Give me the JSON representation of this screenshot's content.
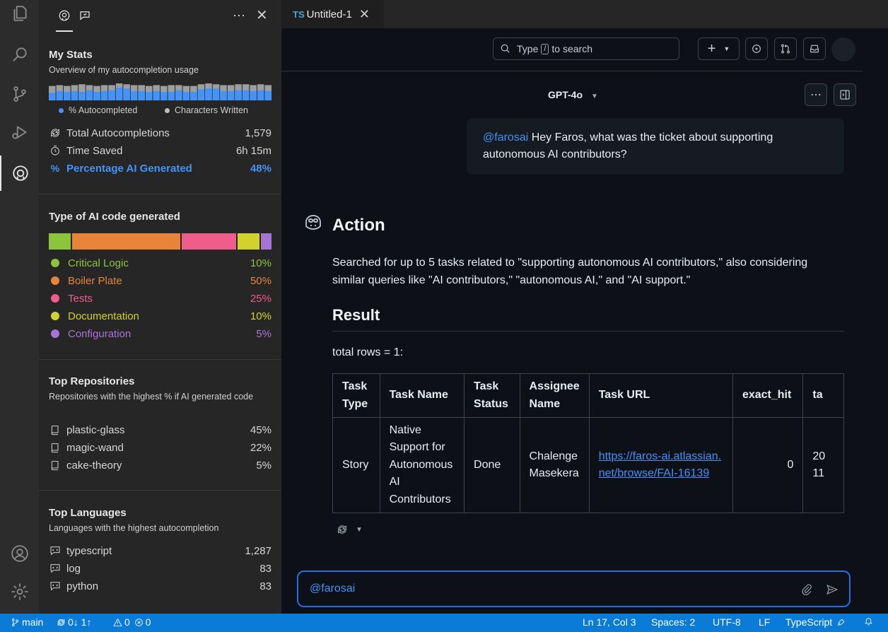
{
  "sidebar": {
    "my_stats": {
      "title": "My Stats",
      "subtitle": "Overview of my autocompletion usage",
      "legend_autocompleted": "% Autocompleted",
      "legend_characters": "Characters Written",
      "rows": [
        {
          "label": "Total Autocompletions",
          "value": "1,579",
          "icon": "refresh-icon"
        },
        {
          "label": "Time Saved",
          "value": "6h 15m",
          "icon": "stopwatch-icon"
        },
        {
          "label": "Percentage AI Generated",
          "value": "48%",
          "icon": "percent-icon"
        }
      ],
      "accent": "#4493f8",
      "bar_autocompleted": [
        0.45,
        0.55,
        0.5,
        0.55,
        0.5,
        0.6,
        0.5,
        0.55,
        0.6,
        0.75,
        0.7,
        0.55,
        0.55,
        0.5,
        0.55,
        0.5,
        0.5,
        0.6,
        0.5,
        0.5,
        0.65,
        0.7,
        0.7,
        0.55,
        0.55,
        0.6,
        0.6,
        0.55,
        0.6,
        0.55
      ],
      "bar_characters": [
        0.85,
        0.9,
        0.85,
        0.9,
        0.95,
        0.9,
        0.85,
        0.9,
        0.9,
        1.0,
        0.95,
        0.9,
        0.9,
        0.85,
        0.9,
        0.85,
        0.9,
        0.9,
        0.85,
        0.85,
        0.95,
        1.0,
        0.95,
        0.9,
        0.9,
        0.95,
        0.95,
        0.9,
        0.95,
        0.9
      ]
    },
    "ai_code": {
      "title": "Type of AI code generated",
      "items": [
        {
          "label": "Critical Logic",
          "value": "10%",
          "color": "#8dc43e",
          "share": 10
        },
        {
          "label": "Boiler Plate",
          "value": "50%",
          "color": "#e8833a",
          "share": 50
        },
        {
          "label": "Tests",
          "value": "25%",
          "color": "#ef5d8d",
          "share": 25
        },
        {
          "label": "Documentation",
          "value": "10%",
          "color": "#d2d22e",
          "share": 10
        },
        {
          "label": "Configuration",
          "value": "5%",
          "color": "#a774d6",
          "share": 5
        }
      ]
    },
    "top_repos": {
      "title": "Top Repositories",
      "subtitle": "Repositories with the highest % if AI generated code",
      "items": [
        {
          "label": "plastic-glass",
          "value": "45%"
        },
        {
          "label": "magic-wand",
          "value": "22%"
        },
        {
          "label": "cake-theory",
          "value": "5%"
        }
      ]
    },
    "top_languages": {
      "title": "Top Languages",
      "subtitle": "Languages with the highest autocompletion",
      "items": [
        {
          "label": "typescript",
          "value": "1,287"
        },
        {
          "label": "log",
          "value": "83"
        },
        {
          "label": "python",
          "value": "83"
        }
      ]
    }
  },
  "editor": {
    "tab_lang": "TS",
    "tab_title": "Untitled-1"
  },
  "toolbar": {
    "search_pre": "Type",
    "search_key": "/",
    "search_post": "to search",
    "plus": "+"
  },
  "chat": {
    "model": "GPT-4o",
    "user_mention": "@farosai",
    "user_message": " Hey Faros, what was the ticket about supporting autonomous AI contributors?",
    "action_heading": "Action",
    "action_text": "Searched for up to 5 tasks related to \"supporting autonomous AI contributors,\" also considering similar queries like \"AI contributors,\" \"autonomous AI,\" and \"AI support.\"",
    "result_heading": "Result",
    "rows_text": "total rows = 1:",
    "table": {
      "headers": [
        "Task Type",
        "Task Name",
        "Task Status",
        "Assignee Name",
        "Task URL",
        "exact_hit",
        "ta"
      ],
      "row": {
        "type": "Story",
        "name": "Native Support for Autonomous AI Contributors",
        "status": "Done",
        "assignee": "Chalenge Masekera",
        "url": "https://faros-ai.atlassian.net/browse/FAI-16139",
        "exact_hit": "0",
        "ta": "20 11"
      }
    },
    "input_value": "@farosai"
  },
  "statusbar": {
    "branch": "main",
    "sync": "0↓ 1↑",
    "warnings": "0",
    "errors": "0",
    "position": "Ln 17, Col 3",
    "spaces": "Spaces: 2",
    "encoding": "UTF-8",
    "eol": "LF",
    "language": "TypeScript",
    "color": "#0a7bd6"
  }
}
